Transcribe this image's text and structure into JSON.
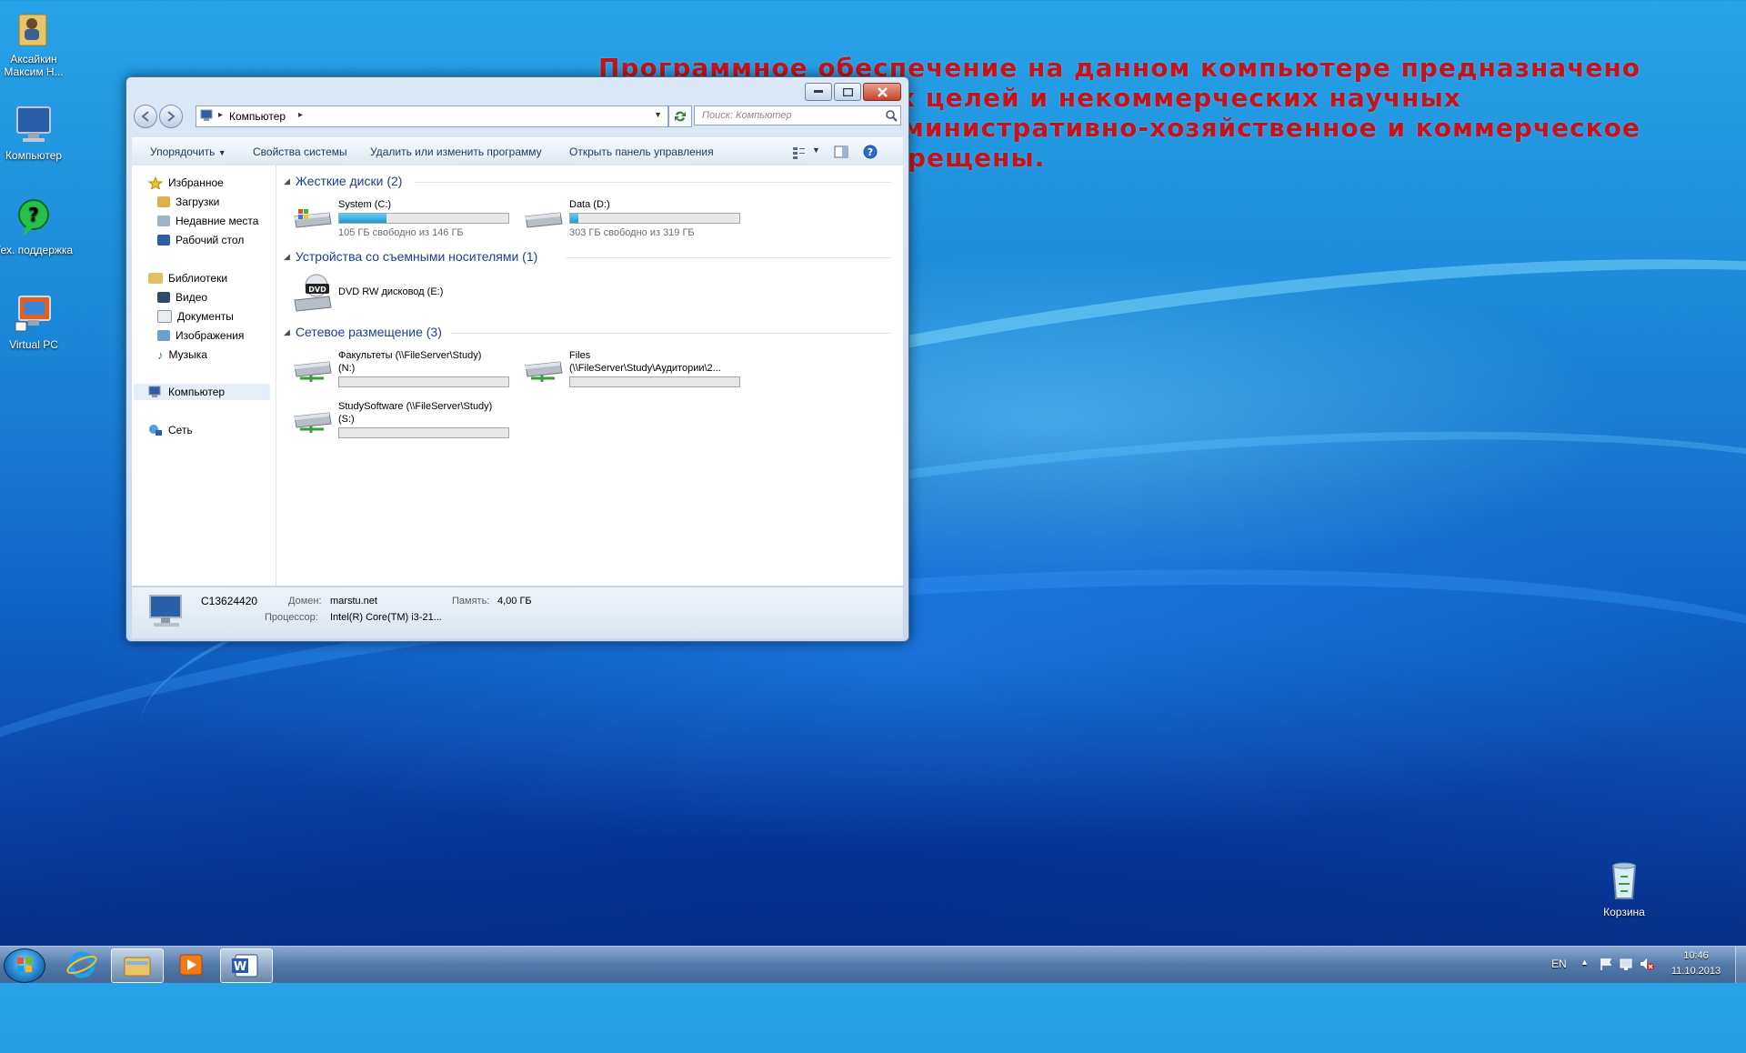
{
  "desktop": {
    "icons": [
      {
        "label": "Аксайкин Максим Н..."
      },
      {
        "label": "Компьютер"
      },
      {
        "label": "Тех. поддержка"
      },
      {
        "label": "Virtual PC"
      }
    ],
    "recycle_bin_label": "Корзина",
    "warning_lines": [
      "Программное обеспечение на данном компьютере предназначено",
      "х целей и некоммерческих научных",
      "министративно-хозяйственное и коммерческое",
      "рещены."
    ]
  },
  "window": {
    "breadcrumb": "Компьютер",
    "search_placeholder": "Поиск: Компьютер",
    "toolbar": {
      "organize": "Упорядочить",
      "system_props": "Свойства системы",
      "uninstall": "Удалить или изменить программу",
      "control_panel": "Открыть панель управления"
    },
    "nav": {
      "favorites": "Избранное",
      "downloads": "Загрузки",
      "recent": "Недавние места",
      "desktop": "Рабочий стол",
      "libraries": "Библиотеки",
      "video": "Видео",
      "documents": "Документы",
      "images": "Изображения",
      "music": "Музыка",
      "computer": "Компьютер",
      "network": "Сеть"
    },
    "groups": {
      "hard_disks": "Жесткие диски (2)",
      "removable": "Устройства со съемными носителями (1)",
      "network": "Сетевое размещение (3)"
    },
    "drives": {
      "c": {
        "name": "System (C:)",
        "free": "105 ГБ свободно из 146 ГБ",
        "used_fraction": 0.28
      },
      "d": {
        "name": "Data (D:)",
        "free": "303 ГБ свободно из 319 ГБ",
        "used_fraction": 0.05
      },
      "e": {
        "name": "DVD RW дисковод (E:)",
        "badge": "DVD"
      },
      "n": {
        "name": "Факультеты (\\\\FileServer\\Study)",
        "letter": "(N:)"
      },
      "files": {
        "name": "Files",
        "path": "(\\\\FileServer\\Study\\Аудитории\\2..."
      },
      "s": {
        "name": "StudySoftware (\\\\FileServer\\Study)",
        "letter": "(S:)"
      }
    },
    "status": {
      "computer_name": "C13624420",
      "domain_label": "Домен:",
      "domain_value": "marstu.net",
      "memory_label": "Память:",
      "memory_value": "4,00 ГБ",
      "cpu_label": "Процессор:",
      "cpu_value": "Intel(R) Core(TM) i3-21..."
    }
  },
  "taskbar": {
    "lang": "EN",
    "time": "10:46",
    "date": "11.10.2013",
    "word_badge": "W",
    "dvd_badge": "DVD",
    "icons": [
      "start-orb-icon",
      "internet-explorer-icon",
      "explorer-icon",
      "media-player-icon",
      "word-icon"
    ]
  },
  "colors": {
    "warning_text": "#c4141b",
    "group_header": "#1e3f8f",
    "drive_fill": "#1d97cf"
  }
}
